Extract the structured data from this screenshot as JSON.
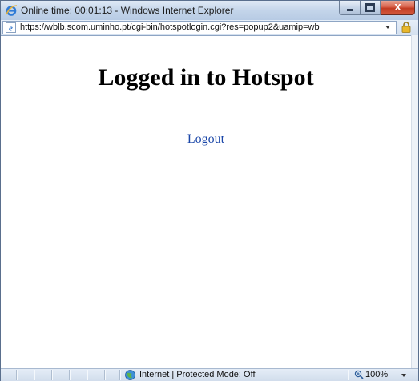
{
  "window": {
    "title": "Online time: 00:01:13 - Windows Internet Explorer",
    "minimize_icon": "minimize-icon",
    "maximize_icon": "maximize-icon",
    "close_label": "X"
  },
  "address_bar": {
    "url": "https://wblb.scom.uminho.pt/cgi-bin/hotspotlogin.cgi?res=popup2&uamip=wb",
    "page_icon": "ie-page-icon",
    "security_icon": "lock-icon"
  },
  "page": {
    "heading": "Logged in to Hotspot",
    "logout_link": "Logout"
  },
  "status_bar": {
    "zone_icon": "globe-icon",
    "zone_text": "Internet | Protected Mode: Off",
    "zoom_icon": "zoom-icon",
    "zoom": "100%"
  },
  "colors": {
    "link": "#1a46a8",
    "close_button": "#c23b22",
    "frame": "#c9d8ea"
  }
}
